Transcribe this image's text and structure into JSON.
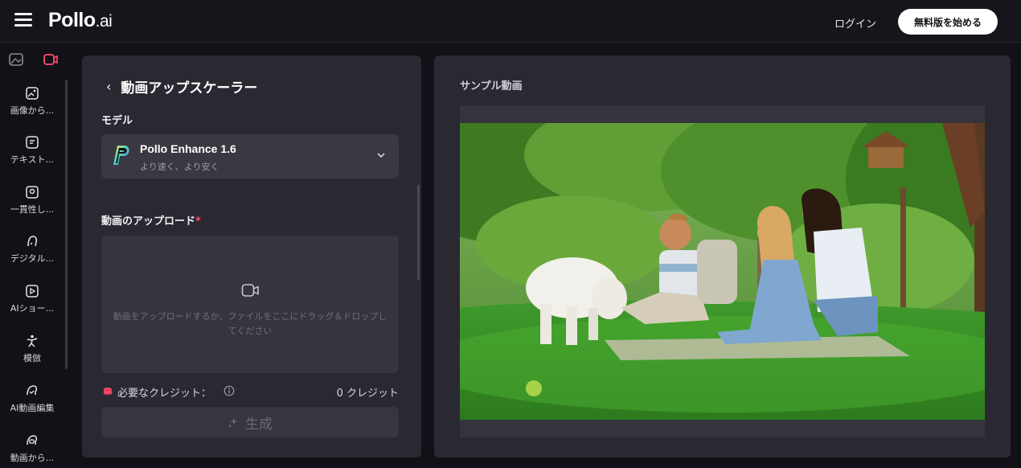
{
  "header": {
    "logo_main": "Pollo",
    "logo_suffix": ".ai",
    "login": "ログイン",
    "signup": "無料版を始める"
  },
  "sidebar": {
    "items": [
      {
        "label": "画像から...",
        "icon": "image-video-icon"
      },
      {
        "label": "テキスト...",
        "icon": "text-video-icon"
      },
      {
        "label": "一貫性し...",
        "icon": "consistent-video-icon"
      },
      {
        "label": "デジタル...",
        "icon": "digital-human-icon"
      },
      {
        "label": "AIショー...",
        "icon": "ai-short-icon"
      },
      {
        "label": "模倣",
        "icon": "motion-imitation-icon"
      },
      {
        "label": "AI動画編集",
        "icon": "ai-video-edit-icon"
      },
      {
        "label": "動画から...",
        "icon": "video-to-video-icon"
      }
    ]
  },
  "tool": {
    "title": "動画アップスケーラー",
    "model_label": "モデル",
    "model_name": "Pollo Enhance 1.6",
    "model_desc": "より速く、より安く",
    "upload_label": "動画のアップロード",
    "upload_required": "*",
    "upload_hint": "動画をアップロードするか、ファイルをここにドラッグ＆ドロップしてください",
    "credits_label": "必要なクレジット：",
    "credits_value": "0 クレジット",
    "generate_label": "生成"
  },
  "preview": {
    "title": "サンプル動画"
  },
  "colors": {
    "accent": "#ff4d6a",
    "panel": "#2a2932",
    "background": "#121118"
  }
}
